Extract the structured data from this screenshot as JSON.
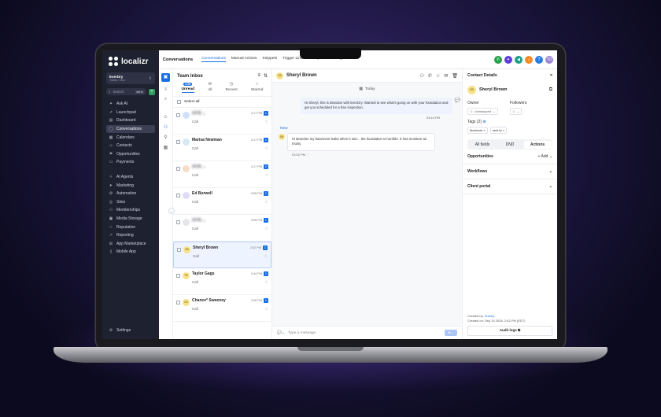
{
  "brand": {
    "name": "localizr"
  },
  "account": {
    "name": "EverDry",
    "location": "Toledo, Ohio"
  },
  "sidebar": {
    "search_label": "Search",
    "search_kbd": "ctrl K",
    "group1": [
      {
        "icon": "ask-ai-icon",
        "label": "Ask AI"
      },
      {
        "icon": "launchpad-icon",
        "label": "Launchpad"
      },
      {
        "icon": "dashboard-icon",
        "label": "Dashboard"
      },
      {
        "icon": "conversations-icon",
        "label": "Conversations",
        "active": true
      },
      {
        "icon": "calendar-icon",
        "label": "Calendars"
      },
      {
        "icon": "contacts-icon",
        "label": "Contacts"
      },
      {
        "icon": "opportunities-icon",
        "label": "Opportunities"
      },
      {
        "icon": "payments-icon",
        "label": "Payments"
      }
    ],
    "group2": [
      {
        "icon": "ai-agents-icon",
        "label": "AI Agents"
      },
      {
        "icon": "marketing-icon",
        "label": "Marketing"
      },
      {
        "icon": "automation-icon",
        "label": "Automation"
      },
      {
        "icon": "sites-icon",
        "label": "Sites"
      },
      {
        "icon": "memberships-icon",
        "label": "Memberships"
      },
      {
        "icon": "media-storage-icon",
        "label": "Media Storage"
      },
      {
        "icon": "reputation-icon",
        "label": "Reputation"
      },
      {
        "icon": "reporting-icon",
        "label": "Reporting"
      },
      {
        "icon": "app-marketplace-icon",
        "label": "App Marketplace"
      },
      {
        "icon": "mobile-app-icon",
        "label": "Mobile App"
      }
    ],
    "settings_label": "Settings"
  },
  "topbar": {
    "section": "Conversations",
    "tabs": [
      {
        "label": "Conversations",
        "active": true
      },
      {
        "label": "Manual Actions"
      },
      {
        "label": "Snippets"
      },
      {
        "label": "Trigger Links"
      },
      {
        "label": "Analytics"
      },
      {
        "label": "Settings"
      }
    ],
    "user_initials": "TO"
  },
  "inbox": {
    "title": "Team Inbox",
    "filters": [
      {
        "label": "Unread",
        "badge": "2.3K",
        "active": true
      },
      {
        "label": "All"
      },
      {
        "label": "Recent"
      },
      {
        "label": "Starred"
      }
    ],
    "select_all": "Select all",
    "conversations": [
      {
        "initials": "",
        "name": "(419) ...",
        "blurred": true,
        "time": "4:17 PM",
        "count": "1",
        "channel": "Call",
        "color": "#cfe0f8"
      },
      {
        "initials": "",
        "name": "Marisa Newman",
        "blurred": false,
        "time": "4:17 PM",
        "count": "1",
        "channel": "Call",
        "color": "#d6e8f4"
      },
      {
        "initials": "",
        "name": "(419) ...",
        "blurred": true,
        "time": "4:17 PM",
        "count": "2",
        "channel": "Call",
        "color": "#f6dcc9"
      },
      {
        "initials": "",
        "name": "Ed Burwell",
        "blurred": false,
        "time": "3:55 PM",
        "count": "1",
        "channel": "Call",
        "color": "#e1dcf6"
      },
      {
        "initials": "",
        "name": "(419) ...",
        "blurred": true,
        "time": "3:55 PM",
        "count": "1",
        "channel": "Call",
        "color": "#e5e5ea"
      },
      {
        "initials": "SB",
        "name": "Sheryl Brown",
        "blurred": false,
        "time": "2:52 PM",
        "count": "1",
        "channel": "Call",
        "color": "#f7e28b",
        "selected": true
      },
      {
        "initials": "TG",
        "name": "Taylor Gags",
        "blurred": false,
        "time": "3:44 PM",
        "count": "1",
        "channel": "Call",
        "color": "#f7e28b"
      },
      {
        "initials": "CS",
        "name": "Chance* Sweeney",
        "blurred": false,
        "time": "3:06 PM",
        "count": "1",
        "channel": "Call",
        "color": "#f7e28b"
      }
    ]
  },
  "chat": {
    "contact_initials": "SB",
    "contact_name": "Sheryl Brown",
    "day_label": "Today",
    "outgoing_text": "Hi Sheryl, this is Brandon with EverDry. Wanted to see what's going on with your foundation and get you scheduled for a free inspection.",
    "outgoing_time": "03:44 PM",
    "new_label": "New",
    "incoming_text": "Hi Brandon my basement leaks when it rain... the foundation is horrible. It has moisture an musty",
    "incoming_time": "03:52 PM",
    "composer_placeholder": "Type a message"
  },
  "contact": {
    "title": "Contact Details",
    "initials": "SB",
    "name": "Sheryl Brown",
    "owner_label": "Owner",
    "owner_value": "Unassigned",
    "followers_label": "Followers",
    "tags_label": "Tags (2)",
    "tags": [
      "facebook",
      "sent fp"
    ],
    "segments": [
      {
        "label": "All fields"
      },
      {
        "label": "DND"
      },
      {
        "label": "Actions",
        "active": true
      }
    ],
    "opportunities_label": "Opportunities",
    "add_label": "Add",
    "workflows_label": "Workflows",
    "client_portal_label": "Client portal",
    "created_by_prefix": "Created by:",
    "created_by": "Survey",
    "created_on": "Created on: Sep 14 2026, 2:42 PM (EDT)",
    "audit_label": "Audit logs"
  },
  "colors": {
    "sidebar_bg": "#1e2230",
    "accent": "#1a6fe0",
    "top_icon_green": "#24a148",
    "top_icon_purple": "#5b3fd6",
    "top_icon_teal": "#1f9e8a",
    "top_icon_orange": "#f28c28",
    "top_icon_blue": "#2b7be4",
    "avatar": "#9b86d6"
  }
}
